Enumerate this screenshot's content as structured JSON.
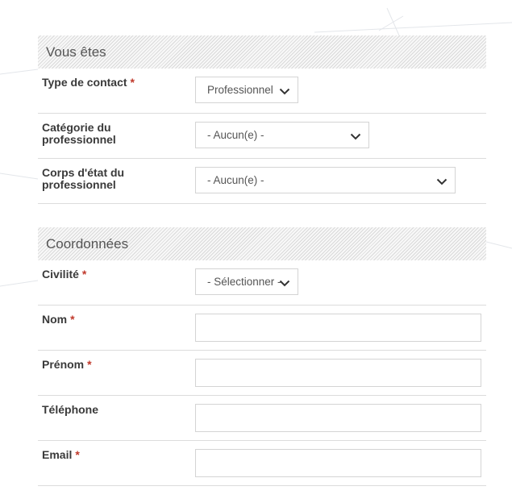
{
  "sections": [
    {
      "title": "Vous êtes",
      "fields": [
        {
          "label": "Type de contact",
          "required": "*",
          "value": "Professionnel"
        },
        {
          "label_line1": "Catégorie du",
          "label_line2": "professionnel",
          "value": "- Aucun(e) -"
        },
        {
          "label_line1": "Corps d'état du",
          "label_line2": "professionnel",
          "value": "- Aucun(e) -"
        }
      ]
    },
    {
      "title": "Coordonnées",
      "fields": [
        {
          "label": "Civilité",
          "required": "*",
          "value": "- Sélectionner -"
        },
        {
          "label": "Nom",
          "required": "*",
          "value": ""
        },
        {
          "label": "Prénom",
          "required": "*",
          "value": ""
        },
        {
          "label": "Téléphone",
          "value": ""
        },
        {
          "label": "Email",
          "required": "*",
          "value": ""
        }
      ]
    }
  ],
  "colors": {
    "required": "#c0392b",
    "label": "#3a3a3a",
    "border": "#d4d4d4",
    "divider": "#dcdcdc"
  },
  "icons": {
    "dropdown": "chevron-down-icon"
  }
}
